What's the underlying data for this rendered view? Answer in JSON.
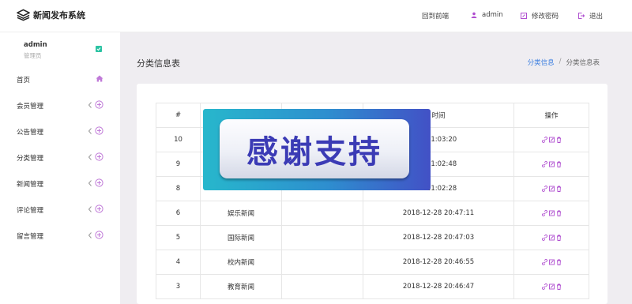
{
  "brand": {
    "title": "新闻发布系统"
  },
  "topnav": {
    "frontend": "回到前端",
    "user": "admin",
    "change_password": "修改密码",
    "logout": "退出"
  },
  "sidebar": {
    "user": {
      "name": "admin",
      "role": "管理员"
    },
    "items": [
      {
        "label": "首页"
      },
      {
        "label": "会员管理"
      },
      {
        "label": "公告管理"
      },
      {
        "label": "分类管理"
      },
      {
        "label": "新闻管理"
      },
      {
        "label": "评论管理"
      },
      {
        "label": "留言管理"
      }
    ]
  },
  "page": {
    "title": "分类信息表",
    "breadcrumb": {
      "link": "分类信息",
      "separator": "/",
      "current": "分类信息表"
    }
  },
  "table": {
    "headers": [
      "#",
      "",
      "",
      "时间",
      "操作"
    ],
    "rows": [
      {
        "id": "10",
        "name": "",
        "desc": "",
        "time": "8 21:03:20"
      },
      {
        "id": "9",
        "name": "",
        "desc": "",
        "time": "8 21:02:48"
      },
      {
        "id": "8",
        "name": "",
        "desc": "",
        "time": "8 21:02:28"
      },
      {
        "id": "6",
        "name": "娱乐新闻",
        "desc": "",
        "time": "2018-12-28 20:47:11"
      },
      {
        "id": "5",
        "name": "国际新闻",
        "desc": "",
        "time": "2018-12-28 20:47:03"
      },
      {
        "id": "4",
        "name": "校内新闻",
        "desc": "",
        "time": "2018-12-28 20:46:55"
      },
      {
        "id": "3",
        "name": "教育新闻",
        "desc": "",
        "time": "2018-12-28 20:46:47"
      }
    ]
  },
  "overlay": {
    "text": "感谢支持"
  },
  "colors": {
    "accent": "#b04fd0",
    "link": "#3d7fe0",
    "check": "#2bc3a3",
    "main_bg": "#efedf1"
  },
  "icons": {
    "row_actions": [
      "link-icon",
      "edit-icon",
      "delete-icon"
    ]
  }
}
